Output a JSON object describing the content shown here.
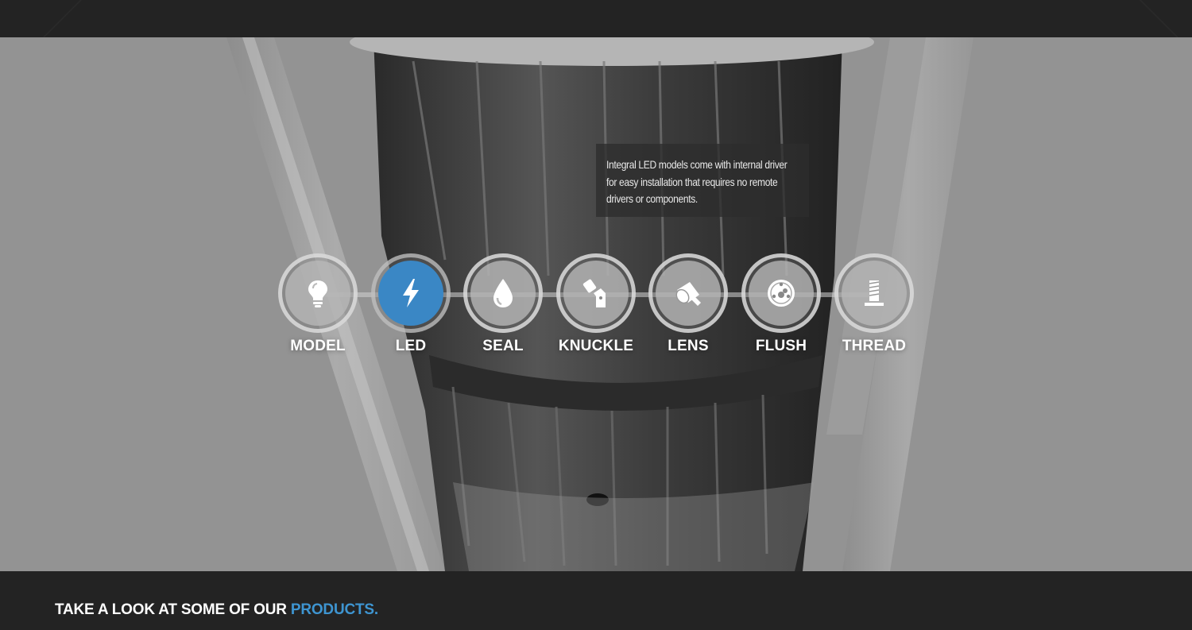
{
  "tooltip": {
    "line1": "Integral LED models come with internal driver",
    "line2": "for easy installation that requires no remote",
    "line3": "drivers or components."
  },
  "features": [
    {
      "label": "MODEL",
      "icon": "lightbulb-icon",
      "active": false
    },
    {
      "label": "LED",
      "icon": "lightning-bolt-icon",
      "active": true
    },
    {
      "label": "SEAL",
      "icon": "water-drop-icon",
      "active": false
    },
    {
      "label": "KNUCKLE",
      "icon": "knuckle-joint-icon",
      "active": false
    },
    {
      "label": "LENS",
      "icon": "lens-icon",
      "active": false
    },
    {
      "label": "FLUSH",
      "icon": "flush-plate-icon",
      "active": false
    },
    {
      "label": "THREAD",
      "icon": "thread-icon",
      "active": false
    }
  ],
  "footer": {
    "heading_prefix": "TAKE A LOOK AT SOME OF OUR",
    "heading_accent": "PRODUCTS."
  },
  "colors": {
    "accent": "#3a87c5",
    "background_dark": "#232323",
    "hero_gray": "#939393"
  }
}
